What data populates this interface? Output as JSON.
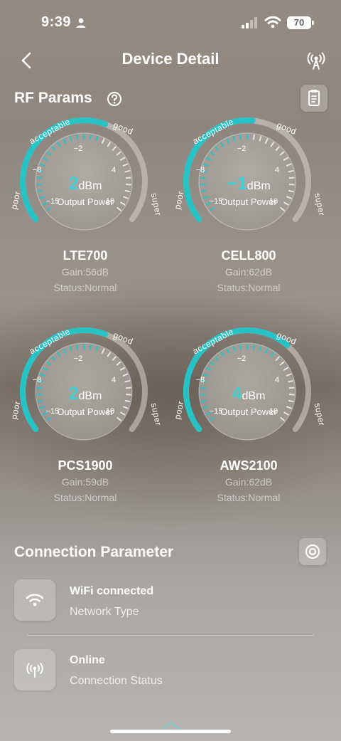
{
  "status_bar": {
    "time": "9:39",
    "battery": "70"
  },
  "header": {
    "title": "Device Detail"
  },
  "rf_section": {
    "title": "RF Params"
  },
  "gauge_labels": {
    "poor": "poor",
    "acceptable": "acceptable",
    "good": "good",
    "super": "super",
    "tick_n2": "−2",
    "tick_n8": "−8",
    "tick_4": "4",
    "tick_n15": "−15",
    "tick_10": "10"
  },
  "gauges": [
    {
      "name": "LTE700",
      "value": "2",
      "unit": "dBm",
      "caption": "Output Power",
      "gain": "Gain:56dB",
      "status": "Status:Normal",
      "level": 0.58
    },
    {
      "name": "CELL800",
      "value": "−1",
      "unit": "dBm",
      "caption": "Output Power",
      "gain": "Gain:62dB",
      "status": "Status:Normal",
      "level": 0.52
    },
    {
      "name": "PCS1900",
      "value": "2",
      "unit": "dBm",
      "caption": "Output Power",
      "gain": "Gain:59dB",
      "status": "Status:Normal",
      "level": 0.58
    },
    {
      "name": "AWS2100",
      "value": "4",
      "unit": "dBm",
      "caption": "Output Power",
      "gain": "Gain:62dB",
      "status": "Status:Normal",
      "level": 0.66
    }
  ],
  "connection": {
    "title": "Connection Parameter",
    "items": [
      {
        "title": "WiFi connected",
        "subtitle": "Network Type",
        "icon": "wifi-icon"
      },
      {
        "title": "Online",
        "subtitle": "Connection Status",
        "icon": "antenna-icon"
      }
    ]
  },
  "colors": {
    "accent": "#26c3c6",
    "track": "#c9c6c3"
  }
}
